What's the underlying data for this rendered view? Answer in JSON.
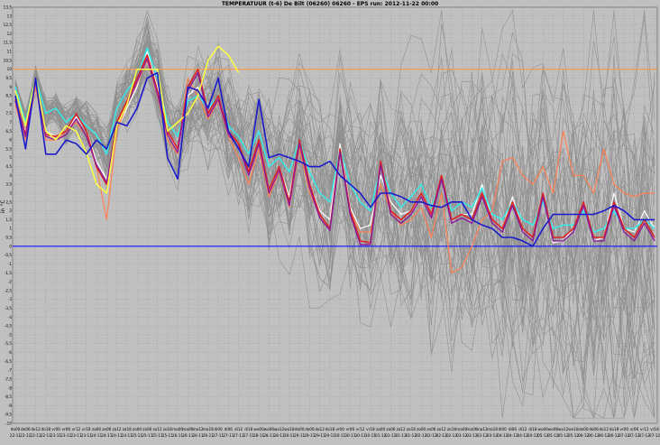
{
  "chart_data": {
    "type": "line",
    "title": "TEMPERATUUR (t-6) De Bilt (06260) 06260 - EPS run: 2012-11-22 00:00",
    "ylabel": "in °C",
    "xlabel": "",
    "ylim": [
      -10,
      13.5
    ],
    "y_tick_step": 0.5,
    "grid": true,
    "reference_lines": [
      {
        "y": 10,
        "color": "#ff9a3c"
      },
      {
        "y": 0,
        "color": "#1010ff"
      }
    ],
    "x_day_labels": [
      "do00",
      "do06",
      "do12",
      "do18",
      "vr00",
      "vr06",
      "vr12",
      "vr18",
      "za00",
      "za06",
      "za12",
      "za18",
      "zo00",
      "zo06",
      "zo12",
      "zo18",
      "ma00",
      "ma06",
      "ma12",
      "ma18",
      "di00",
      "di06",
      "di12",
      "di18",
      "wo00",
      "wo06",
      "wo12",
      "wo18",
      "do00",
      "do06",
      "do12",
      "do18",
      "vr00",
      "vr06",
      "vr12",
      "vr18",
      "za00",
      "za06",
      "za12",
      "za18",
      "zo00",
      "zo06",
      "zo12",
      "zo18",
      "ma00",
      "ma06",
      "ma12",
      "ma18",
      "di00",
      "di06",
      "di12",
      "di18",
      "wo00",
      "wo06",
      "wo12",
      "wo18",
      "do00",
      "do06",
      "do12",
      "do18",
      "vr00",
      "vr06",
      "vr12",
      "vr18"
    ],
    "x_date_labels": [
      "22-11",
      "22-11",
      "22-11",
      "22-11",
      "23-11",
      "23-11",
      "23-11",
      "23-11",
      "24-11",
      "24-11",
      "24-11",
      "24-11",
      "25-11",
      "25-11",
      "25-11",
      "25-11",
      "26-11",
      "26-11",
      "26-11",
      "26-11",
      "27-11",
      "27-11",
      "27-11",
      "27-11",
      "28-11",
      "28-11",
      "28-11",
      "28-11",
      "29-11",
      "29-11",
      "29-11",
      "29-11",
      "30-11",
      "30-11",
      "30-11",
      "30-11",
      "01-12",
      "01-12",
      "01-12",
      "01-12",
      "02-12",
      "02-12",
      "02-12",
      "02-12",
      "03-12",
      "03-12",
      "03-12",
      "03-12",
      "04-12",
      "04-12",
      "04-12",
      "04-12",
      "05-12",
      "05-12",
      "05-12",
      "05-12",
      "06-12",
      "06-12",
      "06-12",
      "06-12",
      "07-12",
      "07-12",
      "07-12",
      "07-12"
    ],
    "series": [
      {
        "color": "#ffffff",
        "width": 1.2,
        "values": [
          8,
          6.5,
          9,
          6.5,
          6.2,
          6.5,
          7.3,
          6.5,
          4.8,
          3.8,
          6.5,
          7.8,
          9,
          11,
          9,
          6.5,
          5.3,
          8.5,
          9,
          7.5,
          8.5,
          6.5,
          5.5,
          4,
          6,
          3,
          4.5,
          2.8,
          5.8,
          3.5,
          2,
          1.5,
          5.8,
          2.2,
          1,
          1.2,
          4,
          2.5,
          1.8,
          2,
          2.8,
          1.8,
          4,
          1.5,
          1.8,
          1.8,
          3.5,
          1.5,
          1,
          2.8,
          1,
          0.5,
          3,
          0.2,
          0.3,
          1,
          2.5,
          0.3,
          0.5,
          3,
          1,
          0.8,
          2,
          1
        ]
      },
      {
        "color": "#30f0f0",
        "width": 1.4,
        "values": [
          9,
          7,
          9.5,
          7.5,
          7.8,
          7,
          7.5,
          6.8,
          6.3,
          5.2,
          7.8,
          8.8,
          9.5,
          11.2,
          9.5,
          7,
          6.2,
          8.2,
          8.5,
          7.8,
          8.5,
          6.8,
          6.2,
          5.2,
          6.5,
          4.5,
          5,
          4.2,
          6,
          4.2,
          3,
          2.5,
          5.5,
          3.5,
          2.5,
          2,
          4.5,
          3,
          2.2,
          2.8,
          3.5,
          2.2,
          3.8,
          2,
          2.5,
          2.2,
          3.3,
          1.8,
          1.5,
          2.5,
          1.5,
          1.2,
          2.5,
          1,
          1.2,
          1.2,
          2,
          0.8,
          1,
          2,
          1,
          1,
          1.5,
          1
        ]
      },
      {
        "color": "#ff8050",
        "width": 1.2,
        "values": [
          8,
          6,
          9,
          6,
          6,
          6.5,
          7,
          6.2,
          4.5,
          1.5,
          6.5,
          8,
          9.2,
          10.5,
          8.5,
          6,
          5.2,
          9.5,
          8.5,
          7.2,
          8.2,
          6.2,
          5,
          3.5,
          5.5,
          2.8,
          4.2,
          2.2,
          5.5,
          3,
          1.8,
          1,
          5.2,
          2,
          0.8,
          0.8,
          3.5,
          2,
          1.2,
          1.5,
          2.2,
          0.5,
          3,
          -1.5,
          -1.2,
          0,
          1.5,
          2,
          4.8,
          5,
          4,
          3.5,
          4.5,
          3,
          6.5,
          4,
          4,
          3,
          5.5,
          3.5,
          3,
          2.8,
          3,
          3
        ]
      },
      {
        "color": "#dd2222",
        "width": 1.6,
        "values": [
          8.3,
          6.3,
          9.5,
          6.3,
          6.2,
          6.5,
          7.5,
          6.5,
          4.5,
          3.5,
          7,
          8.2,
          9.5,
          10.8,
          8.8,
          6.5,
          5.5,
          9,
          10,
          7.5,
          8.5,
          6.5,
          5.8,
          4.2,
          6,
          3.2,
          4.5,
          2.5,
          6,
          3.5,
          1.8,
          1,
          5.5,
          2,
          0.3,
          0.2,
          4.8,
          2,
          1.5,
          2,
          3,
          1.8,
          4,
          1.5,
          1.8,
          1.5,
          3,
          1.5,
          1,
          2.5,
          1,
          0.5,
          3,
          0.5,
          0.5,
          1,
          2.5,
          0.5,
          0.5,
          2.5,
          1,
          0.5,
          1.5,
          0.5
        ]
      },
      {
        "color": "#8a1a9a",
        "width": 1.4,
        "values": [
          8.2,
          6.2,
          9.3,
          6.2,
          6,
          6.3,
          7.2,
          6.2,
          4.6,
          3.6,
          6.8,
          8,
          9.3,
          10.6,
          8.6,
          6.3,
          5.3,
          8.8,
          9.8,
          7.3,
          8.3,
          6.3,
          5.6,
          4,
          5.8,
          3,
          4.3,
          2.3,
          5.8,
          3.3,
          1.6,
          0.9,
          5.3,
          1.8,
          0.1,
          0.1,
          4.6,
          1.8,
          1.3,
          1.8,
          2.8,
          1.6,
          3.8,
          1.3,
          1.6,
          1.3,
          2.8,
          1.3,
          0.8,
          2.3,
          0.8,
          0.3,
          2.8,
          0.3,
          0.3,
          0.8,
          2.3,
          0.3,
          0.3,
          2.3,
          0.8,
          0.3,
          1.3,
          0.3
        ]
      },
      {
        "color": "#ffff40",
        "width": 1.5,
        "values": [
          8.8,
          6.8,
          9.5,
          6.5,
          6,
          6.8,
          6.5,
          5.3,
          3.5,
          3,
          6.8,
          8,
          10,
          10,
          10,
          6.5,
          7,
          7.5,
          8.5,
          10.5,
          11.3,
          10.8,
          9.8,
          null,
          null,
          null,
          null,
          null,
          null,
          null,
          null,
          null,
          null,
          null,
          null,
          null,
          null,
          null,
          null,
          null,
          null,
          null,
          null,
          null,
          null,
          null,
          null,
          null,
          null,
          null,
          null,
          null,
          null,
          null,
          null,
          null,
          null,
          null,
          null,
          null,
          null,
          null,
          null,
          null
        ]
      },
      {
        "color": "#1a1acc",
        "width": 1.6,
        "values": [
          8.5,
          5.5,
          9.5,
          5.2,
          5.2,
          6,
          5.8,
          5.2,
          6,
          5.5,
          7,
          6.8,
          7.8,
          9.5,
          9.8,
          5,
          3.8,
          9,
          8.8,
          7.8,
          9.5,
          6.5,
          5.5,
          4.5,
          8.3,
          5,
          5.2,
          5,
          4.8,
          4.5,
          4.5,
          4.8,
          4,
          3.5,
          3,
          2.2,
          3,
          3,
          2.8,
          2.5,
          2.5,
          2.3,
          2.2,
          2.5,
          2.5,
          1.5,
          1.2,
          1,
          0.5,
          0.5,
          0.3,
          0,
          1,
          1.8,
          1.8,
          1.8,
          1.8,
          1.8,
          2,
          2.3,
          2,
          1.5,
          1.5,
          1.5
        ]
      }
    ]
  }
}
